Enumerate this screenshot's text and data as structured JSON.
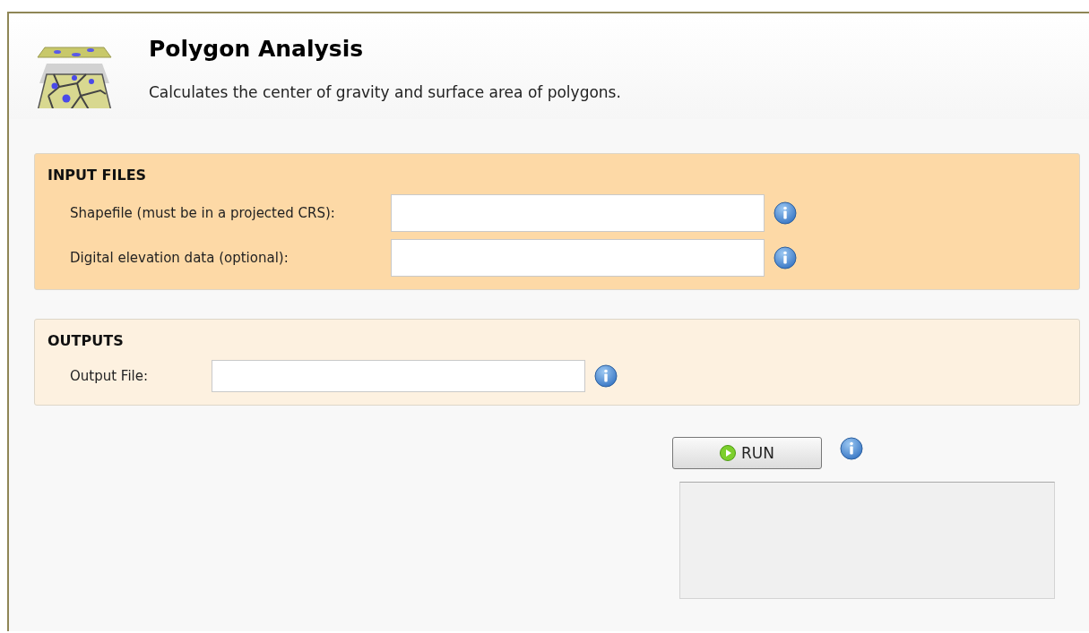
{
  "header": {
    "title": "Polygon Analysis",
    "description": "Calculates the center of gravity and surface area of polygons."
  },
  "sections": [
    {
      "title": "INPUT FILES",
      "color": "#fdd9a6",
      "fields": [
        {
          "label": "Shapefile (must be in a projected CRS):"
        },
        {
          "label": "Digital elevation data (optional):"
        }
      ]
    },
    {
      "title": "OUTPUTS",
      "color": "#fdf1e0",
      "fields": [
        {
          "label": "Output File:"
        }
      ]
    }
  ],
  "run_button": {
    "label": "RUN"
  }
}
